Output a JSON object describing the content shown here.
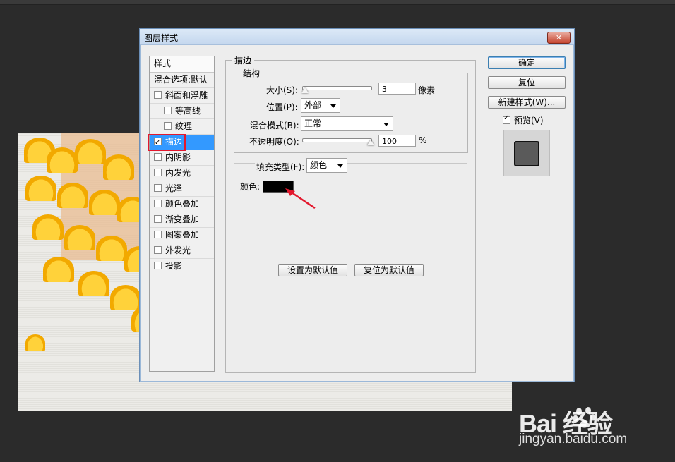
{
  "dialog": {
    "title": "图层样式",
    "close_label": "✕"
  },
  "styles_list": {
    "header": "样式",
    "blend_options": "混合选项:默认",
    "items": [
      {
        "label": "斜面和浮雕",
        "checked": false,
        "sub": false
      },
      {
        "label": "等高线",
        "checked": false,
        "sub": true
      },
      {
        "label": "纹理",
        "checked": false,
        "sub": true
      },
      {
        "label": "描边",
        "checked": true,
        "sub": false,
        "selected": true
      },
      {
        "label": "内阴影",
        "checked": false,
        "sub": false
      },
      {
        "label": "内发光",
        "checked": false,
        "sub": false
      },
      {
        "label": "光泽",
        "checked": false,
        "sub": false
      },
      {
        "label": "颜色叠加",
        "checked": false,
        "sub": false
      },
      {
        "label": "渐变叠加",
        "checked": false,
        "sub": false
      },
      {
        "label": "图案叠加",
        "checked": false,
        "sub": false
      },
      {
        "label": "外发光",
        "checked": false,
        "sub": false
      },
      {
        "label": "投影",
        "checked": false,
        "sub": false
      }
    ]
  },
  "stroke": {
    "legend": "描边",
    "structure": {
      "legend": "结构",
      "size_label": "大小(S):",
      "size_value": "3",
      "size_unit": "像素",
      "size_slider_fraction": 0.02,
      "position_label": "位置(P):",
      "position_value": "外部",
      "blend_label": "混合模式(B):",
      "blend_value": "正常",
      "opacity_label": "不透明度(O):",
      "opacity_value": "100",
      "opacity_unit": "%",
      "opacity_slider_fraction": 1.0
    },
    "fill": {
      "type_label": "填充类型(F):",
      "type_value": "颜色",
      "color_label": "颜色:",
      "color_value": "#000000"
    },
    "set_default": "设置为默认值",
    "reset_default": "复位为默认值"
  },
  "side": {
    "ok": "确定",
    "reset": "复位",
    "new_style": "新建样式(W)...",
    "preview_label": "预览(V)",
    "preview_checked": true
  },
  "watermark": {
    "brand": "Bai  经验",
    "url": "jingyan.baidu.com"
  },
  "colors": {
    "selection": "#3399ff",
    "highlight_box": "#e3182d",
    "annotation_arrow": "#e3182d"
  }
}
